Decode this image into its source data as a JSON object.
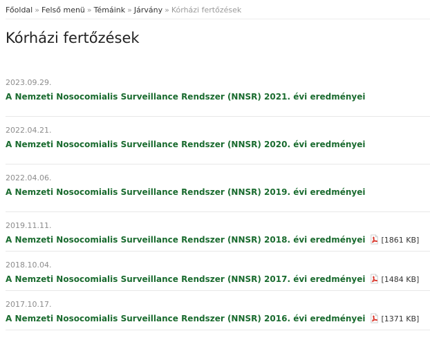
{
  "breadcrumb": {
    "items": [
      "Főoldal",
      "Felső menü",
      "Témáink",
      "Járvány"
    ],
    "separator": "»",
    "current": "Kórházi fertőzések"
  },
  "page": {
    "title": "Kórházi fertőzések"
  },
  "colors": {
    "link": "#1a6b2f",
    "date": "#8c8c8c",
    "pdf_icon": "#d93025"
  },
  "documents": [
    {
      "date": "2023.09.29.",
      "title": "A Nemzeti Nosocomialis Surveillance Rendszer (NNSR) 2021. évi eredményei",
      "icon": "",
      "size": ""
    },
    {
      "date": "2022.04.21.",
      "title": "A Nemzeti Nosocomialis Surveillance Rendszer (NNSR) 2020. évi eredményei",
      "icon": "",
      "size": ""
    },
    {
      "date": "2022.04.06.",
      "title": "A Nemzeti Nosocomialis Surveillance Rendszer (NNSR) 2019. évi eredményei",
      "icon": "",
      "size": ""
    },
    {
      "date": "2019.11.11.",
      "title": "A Nemzeti Nosocomialis Surveillance Rendszer (NNSR) 2018. évi eredményei",
      "icon": "pdf-icon",
      "size": "[1861 KB]"
    },
    {
      "date": "2018.10.04.",
      "title": "A Nemzeti Nosocomialis Surveillance Rendszer (NNSR) 2017. évi eredményei",
      "icon": "pdf-icon",
      "size": "[1484 KB]"
    },
    {
      "date": "2017.10.17.",
      "title": "A Nemzeti Nosocomialis Surveillance Rendszer (NNSR) 2016. évi eredményei",
      "icon": "pdf-icon",
      "size": "[1371 KB]"
    }
  ]
}
